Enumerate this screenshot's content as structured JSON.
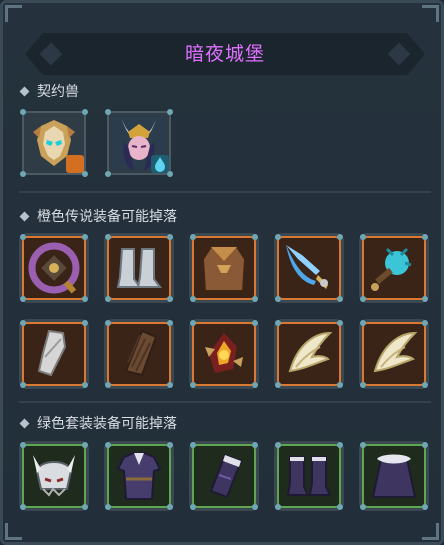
{
  "title": "暗夜城堡",
  "sections": {
    "pets": {
      "label": "契约兽"
    },
    "orange": {
      "label": "橙色传说装备可能掉落"
    },
    "green": {
      "label": "绿色套装装备可能掉落"
    }
  },
  "pets": [
    {
      "name": "golden-mask-beast",
      "element_icon": "fire-element-icon"
    },
    {
      "name": "horned-witch-beast",
      "element_icon": "water-drop-icon"
    }
  ],
  "orange_items": [
    "spiked-shield-icon",
    "silver-boots-icon",
    "bronze-cuirass-icon",
    "ice-spear-icon",
    "frost-mace-icon",
    "silver-bracer-icon",
    "bronze-bracer-icon",
    "flame-gem-icon",
    "white-wing-icon",
    "white-wing-icon"
  ],
  "green_items": [
    "horned-helmet-icon",
    "purple-robe-icon",
    "purple-gauntlet-icon",
    "purple-boots-icon",
    "purple-cape-icon"
  ],
  "colors": {
    "title": "#e070ff",
    "legendary": "#d97933",
    "set": "#5fa554"
  }
}
